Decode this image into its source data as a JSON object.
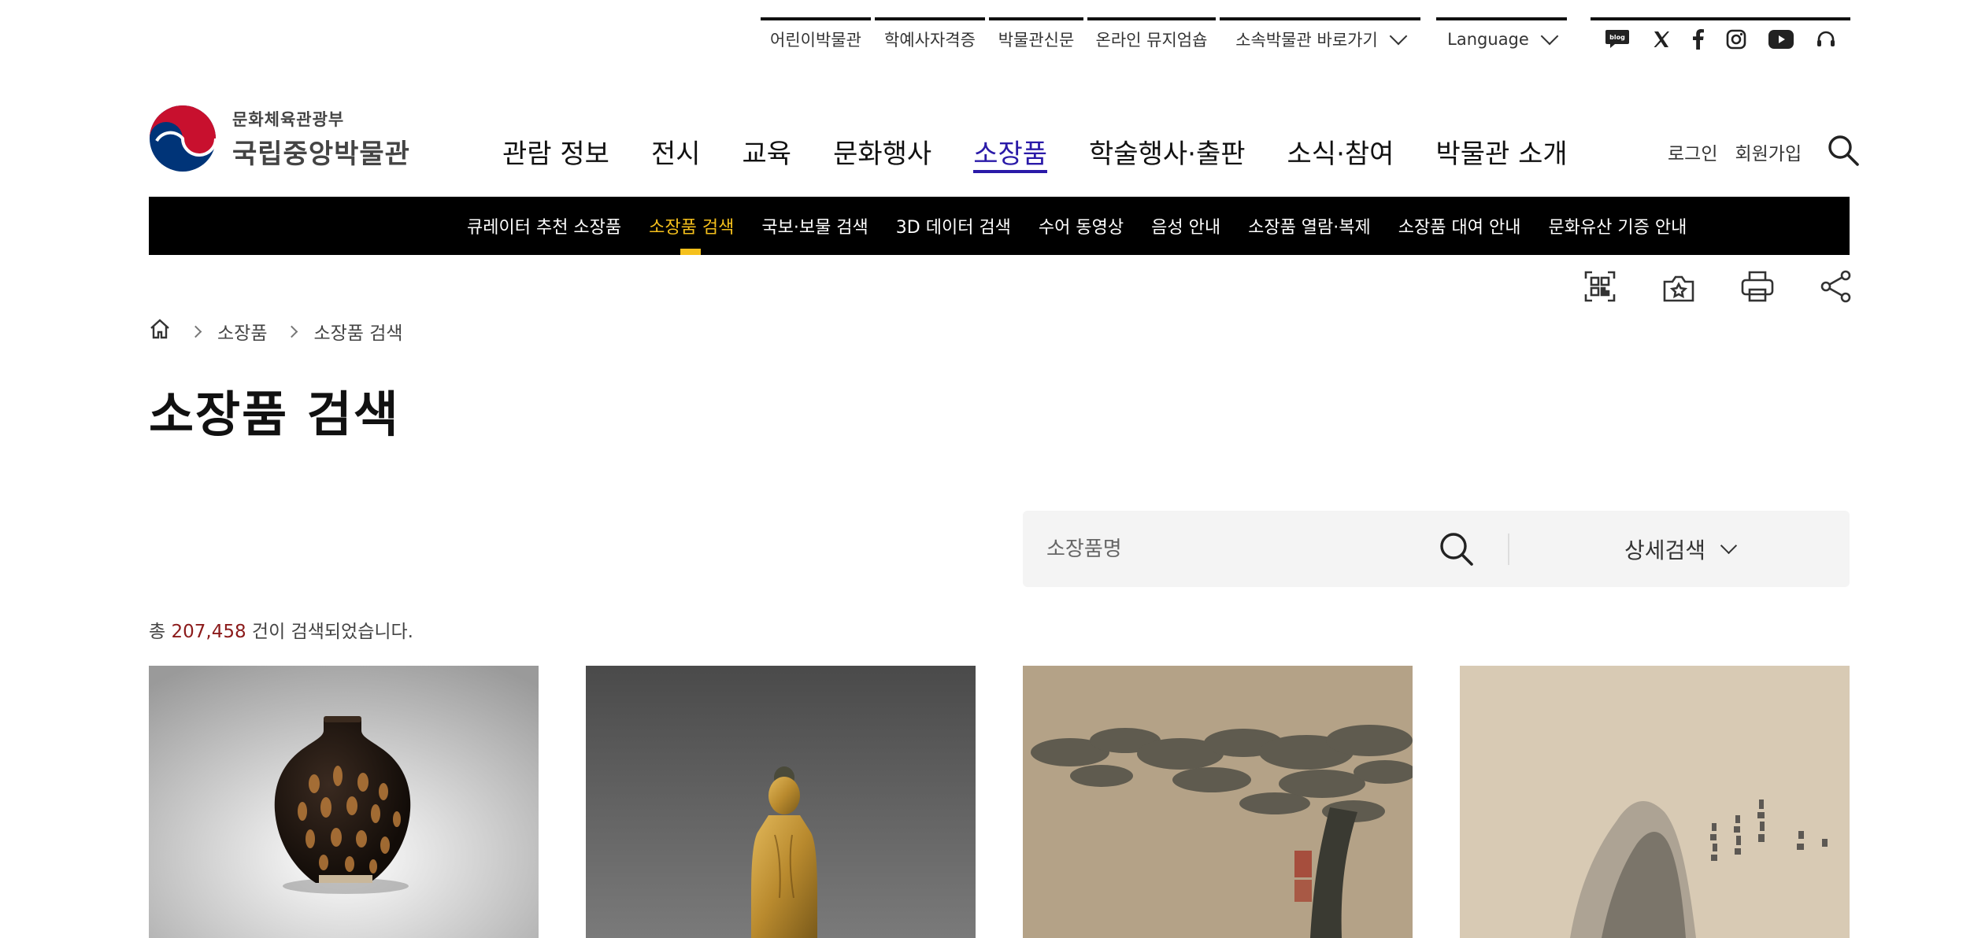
{
  "util_nav": {
    "items": [
      {
        "label": "어린이박물관"
      },
      {
        "label": "학예사자격증"
      },
      {
        "label": "박물관신문"
      },
      {
        "label": "온라인 뮤지엄숍"
      },
      {
        "label": "소속박물관 바로가기"
      }
    ],
    "language": "Language",
    "social": [
      "blog-icon",
      "x-icon",
      "facebook-icon",
      "instagram-icon",
      "youtube-icon",
      "headset-icon"
    ],
    "blog_text": "blog"
  },
  "logo": {
    "ministry": "문화체육관광부",
    "museum": "국립중앙박물관",
    "colors": {
      "red": "#c8102e",
      "blue": "#003478"
    }
  },
  "gnb": {
    "items": [
      {
        "label": "관람 정보"
      },
      {
        "label": "전시"
      },
      {
        "label": "교육"
      },
      {
        "label": "문화행사"
      },
      {
        "label": "소장품"
      },
      {
        "label": "학술행사·출판"
      },
      {
        "label": "소식·참여"
      },
      {
        "label": "박물관 소개"
      }
    ],
    "active": "소장품"
  },
  "member": {
    "login": "로그인",
    "signup": "회원가입"
  },
  "lnb": {
    "items": [
      {
        "label": "큐레이터 추천 소장품"
      },
      {
        "label": "소장품 검색"
      },
      {
        "label": "국보·보물 검색"
      },
      {
        "label": "3D 데이터 검색"
      },
      {
        "label": "수어 동영상"
      },
      {
        "label": "음성 안내"
      },
      {
        "label": "소장품 열람·복제"
      },
      {
        "label": "소장품 대여 안내"
      },
      {
        "label": "문화유산 기증 안내"
      }
    ],
    "active": "소장품 검색",
    "accent": "#f5c01c"
  },
  "breadcrumb": [
    "소장품",
    "소장품 검색"
  ],
  "page_title": "소장품 검색",
  "search": {
    "placeholder": "소장품명",
    "detail_label": "상세검색"
  },
  "result": {
    "prefix": "총 ",
    "count": "207,458",
    "suffix": " 건이 검색되었습니다.",
    "count_color": "#8b1a1a"
  },
  "cards": [
    {
      "subject": "black-glazed-jar"
    },
    {
      "subject": "gilt-bronze-buddha"
    },
    {
      "subject": "tree-ink-painting"
    },
    {
      "subject": "landscape-ink-painting"
    }
  ]
}
